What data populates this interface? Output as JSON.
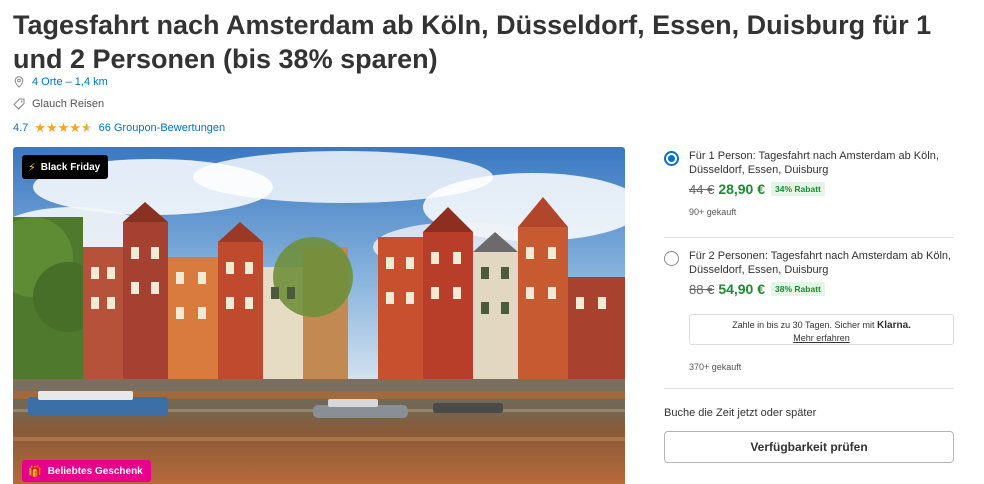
{
  "deal": {
    "title": "Tagesfahrt nach Amsterdam ab Köln, Düsseldorf, Essen, Duisburg für 1 und 2 Personen (bis 38% sparen)",
    "location": "4 Orte – 1,4 km",
    "vendor": "Glauch Reisen",
    "rating": "4.7",
    "stars": 4.5,
    "reviews": "66 Groupon-Bewertungen"
  },
  "image": {
    "badge_top": "Black Friday",
    "badge_bottom": "Beliebtes Geschenk"
  },
  "options": [
    {
      "title": "Für 1 Person: Tagesfahrt nach Amsterdam ab Köln, Düsseldorf, Essen, Duisburg",
      "old_price": "44 €",
      "new_price": "28,90 €",
      "discount": "34% Rabatt",
      "bought": "90+ gekauft",
      "selected": true
    },
    {
      "title": "Für 2 Personen: Tagesfahrt nach Amsterdam ab Köln, Düsseldorf, Essen, Duisburg",
      "old_price": "88 €",
      "new_price": "54,90 €",
      "discount": "38% Rabatt",
      "bought": "370+ gekauft",
      "selected": false
    }
  ],
  "klarna": {
    "text": "Zahle in bis zu 30 Tagen. Sicher mit",
    "logo": "Klarna.",
    "link": "Mehr erfahren"
  },
  "booking": {
    "label": "Buche die Zeit jetzt oder später",
    "button": "Verfügbarkeit prüfen"
  },
  "colors": {
    "link": "#0073c8",
    "price": "#1a8c2e",
    "star": "#f5a623",
    "gift_badge": "#e6008c"
  },
  "icons": {
    "location": "map-pin-icon",
    "vendor": "tag-icon",
    "black_friday": "lightning-icon",
    "gift": "gift-icon"
  }
}
